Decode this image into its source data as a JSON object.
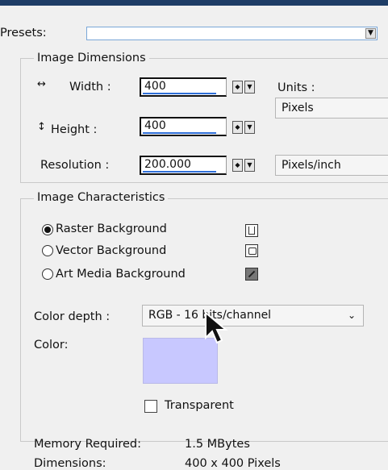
{
  "presets": {
    "label": "Presets:",
    "value": ""
  },
  "image_dimensions": {
    "legend": "Image Dimensions",
    "width_label": "Width :",
    "width_value": "400",
    "height_label": "Height :",
    "height_value": "400",
    "resolution_label": "Resolution :",
    "resolution_value": "200.000",
    "units_label": "Units :",
    "units_value": "Pixels",
    "resolution_units_value": "Pixels/inch"
  },
  "image_characteristics": {
    "legend": "Image Characteristics",
    "options": [
      {
        "label": "Raster Background",
        "selected": true
      },
      {
        "label": "Vector Background",
        "selected": false
      },
      {
        "label": "Art Media Background",
        "selected": false
      }
    ],
    "color_depth_label": "Color depth :",
    "color_depth_value": "RGB - 16 bits/channel",
    "color_label": "Color:",
    "color_swatch": "#c8c8ff",
    "transparent_label": "Transparent",
    "transparent_checked": false
  },
  "summary": {
    "memory_label": "Memory Required:",
    "memory_value": "1.5 MBytes",
    "dimensions_label": "Dimensions:",
    "dimensions_value": "400 x 400 Pixels"
  },
  "icons": {
    "width": "horizontal-arrows-icon",
    "height": "vertical-arrows-icon",
    "cursor": "mouse-pointer-icon"
  }
}
